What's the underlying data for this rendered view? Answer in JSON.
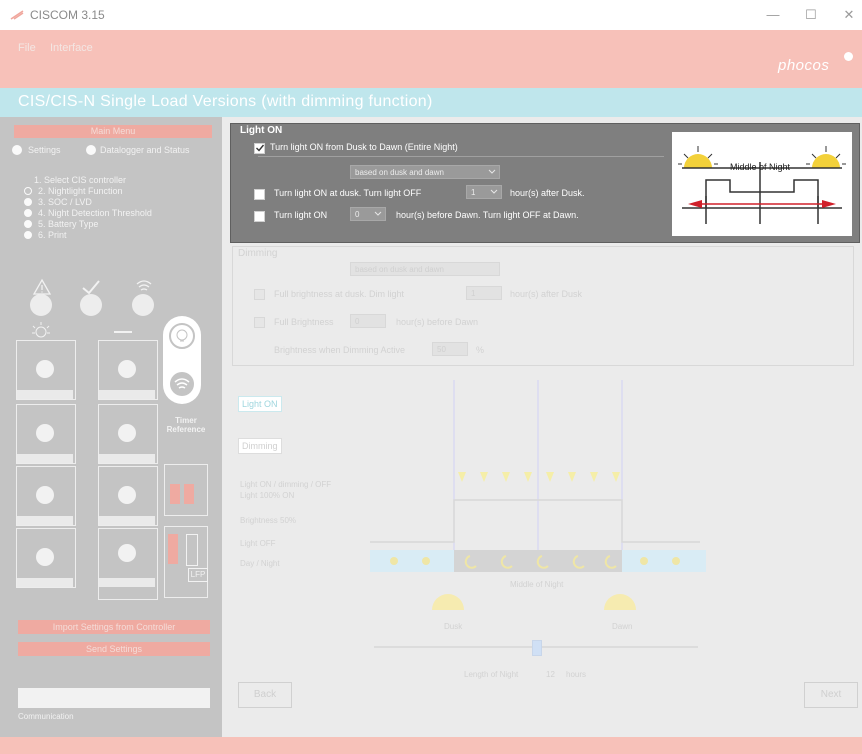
{
  "window": {
    "title": "CISCOM 3.15",
    "min": "—",
    "max": "☐",
    "close": "✕"
  },
  "menu": {
    "file": "File",
    "interface": "Interface"
  },
  "brand": {
    "logo": "phocos"
  },
  "page": {
    "title": "CIS/CIS-N Single Load Versions (with dimming function)"
  },
  "sidebar": {
    "main_menu": "Main Menu",
    "mode_settings": "Settings",
    "mode_datalogger": "Datalogger and Status",
    "steps": [
      "1. Select CIS controller",
      "2. Nightlight Function",
      "3. SOC / LVD",
      "4. Night Detection Threshold",
      "5. Battery Type",
      "6. Print"
    ],
    "timer_reference": "Timer Reference",
    "lfp": "LFP",
    "import_button": "Import Settings from Controller",
    "send_button": "Send Settings",
    "communication": "Communication"
  },
  "light_on": {
    "legend": "Light ON",
    "opt_entire_night": "Turn light ON from Dusk to Dawn (Entire Night)",
    "based_on": "based on dusk and dawn",
    "opt_dusk_prefix": "Turn light ON at dusk. Turn light OFF",
    "opt_dusk_value": "1",
    "opt_dusk_suffix": "hour(s) after Dusk.",
    "opt_before_prefix": "Turn light ON",
    "opt_before_value": "0",
    "opt_before_suffix": "hour(s) before Dawn. Turn light OFF at Dawn.",
    "diagram_label": "Middle of Night"
  },
  "dimming": {
    "legend": "Dimming",
    "based_on": "based on dusk and dawn",
    "opt_full_prefix": "Full brightness at dusk. Dim light",
    "opt_full_value": "1",
    "opt_full_suffix": "hour(s) after Dusk",
    "opt_before_prefix": "Full Brightness",
    "opt_before_value": "0",
    "opt_before_suffix": "hour(s) before Dawn",
    "brightness_label": "Brightness when Dimming Active",
    "brightness_value": "50",
    "brightness_unit": "%"
  },
  "timeline": {
    "light_on": "Light ON",
    "dimming": "Dimming",
    "row_states": "Light ON / dimming / OFF",
    "row_full": "Light 100% ON",
    "row_dim": "Brightness 50%",
    "row_off": "Light OFF",
    "row_daynight": "Day / Night",
    "middle": "Middle of Night",
    "dusk": "Dusk",
    "dawn": "Dawn",
    "length_label": "Length of Night",
    "length_value": "12",
    "length_unit": "hours",
    "slider_fraction": 0.5
  },
  "nav": {
    "back": "Back",
    "next": "Next"
  },
  "colors": {
    "header": "#f7c1b9",
    "band": "#bfe6ec",
    "accent": "#d0202a",
    "sidebar": "#c4c4c4"
  }
}
